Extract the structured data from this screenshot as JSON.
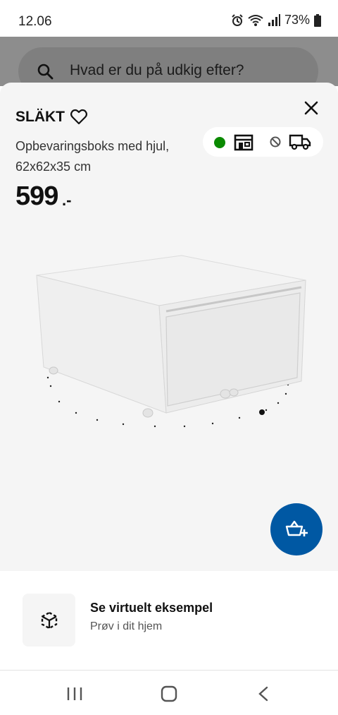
{
  "status": {
    "time": "12.06",
    "battery": "73%"
  },
  "search": {
    "placeholder": "Hvad er du på udkig efter?"
  },
  "product": {
    "name": "SLÄKT",
    "description": "Opbevaringsboks med hjul, 62x62x35 cm",
    "price": "599",
    "price_suffix": ".-"
  },
  "availability": {
    "in_store_color": "#0a8a00",
    "icons": [
      "store-icon",
      "blocked-icon",
      "delivery-truck-icon"
    ]
  },
  "fab": {
    "icon": "add-to-cart-icon",
    "color": "#0058a3"
  },
  "ar": {
    "title": "Se virtuelt eksempel",
    "subtitle": "Prøv i dit hjem",
    "icon": "ar-cube-icon"
  },
  "navbar": {
    "icons": [
      "recents-icon",
      "home-icon",
      "back-icon"
    ]
  }
}
